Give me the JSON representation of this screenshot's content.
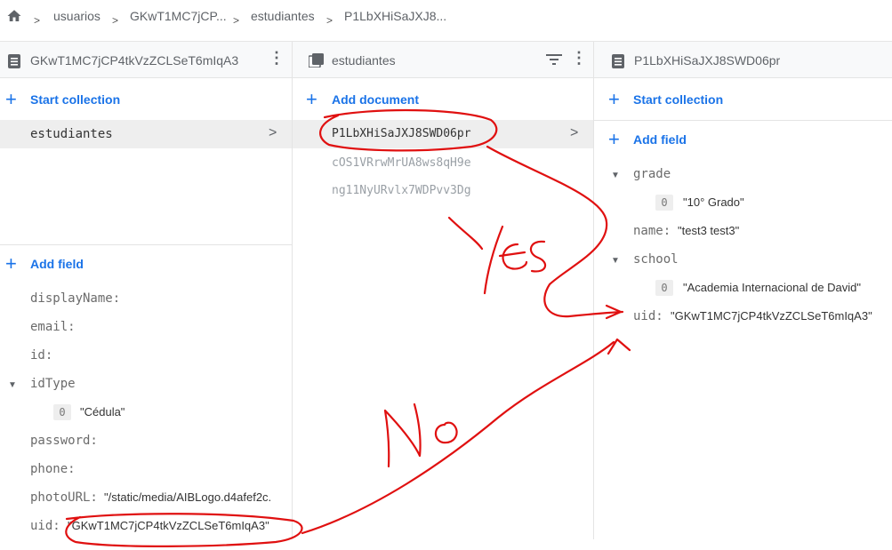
{
  "breadcrumb": {
    "items": [
      "usuarios",
      "GKwT1MC7jCP...",
      "estudiantes",
      "P1LbXHiSaJXJ8..."
    ]
  },
  "col1": {
    "title": "GKwT1MC7jCP4tkVzZCLSeT6mIqA3",
    "start_collection": "Start collection",
    "collections": [
      "estudiantes"
    ],
    "add_field": "Add field",
    "fields": {
      "displayName": "displayName:",
      "email": "email:",
      "id": "id:",
      "idType": "idType",
      "idType_index": "0",
      "idType_value": "\"Cédula\"",
      "password": "password:",
      "phone": "phone:",
      "photoURL": "photoURL:",
      "photoURL_value": "\"/static/media/AIBLogo.d4afef2c.",
      "uid": "uid:",
      "uid_value": "\"GKwT1MC7jCP4tkVzZCLSeT6mIqA3\""
    }
  },
  "col2": {
    "title": "estudiantes",
    "add_document": "Add document",
    "documents": [
      "P1LbXHiSaJXJ8SWD06pr",
      "cOS1VRrwMrUA8ws8qH9e",
      "ng11NyURvlx7WDPvv3Dg"
    ]
  },
  "col3": {
    "title": "P1LbXHiSaJXJ8SWD06pr",
    "start_collection": "Start collection",
    "add_field": "Add field",
    "fields": {
      "grade": "grade",
      "grade_index": "0",
      "grade_value": "\"10° Grado\"",
      "name": "name:",
      "name_value": "\"test3 test3\"",
      "school": "school",
      "school_index": "0",
      "school_value": "\"Academia Internacional de David\"",
      "uid": "uid:",
      "uid_value": "\"GKwT1MC7jCP4tkVzZCLSeT6mIqA3\""
    }
  },
  "annotations": {
    "yes": "Yes",
    "no": "No",
    "color": "#e01010"
  },
  "colors": {
    "accent": "#1a73e8"
  }
}
